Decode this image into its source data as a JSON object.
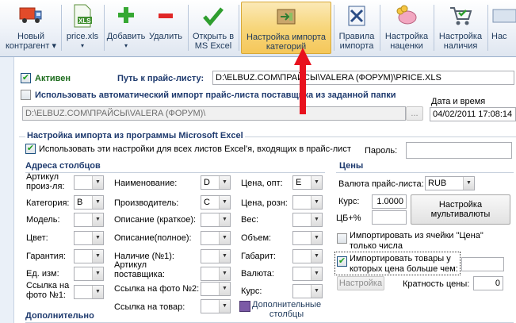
{
  "toolbar": {
    "buttons": [
      {
        "label1": "Новый",
        "label2": "контрагент ▾",
        "icon": "truck-icon"
      },
      {
        "label1": "price.xls",
        "label2": "▾",
        "icon": "xls-file-icon",
        "badge": "XLS"
      },
      {
        "label1": "Добавить",
        "label2": "▾",
        "icon": "plus-icon"
      },
      {
        "label1": "Удалить",
        "label2": "",
        "icon": "minus-icon"
      },
      {
        "label1": "Открыть в",
        "label2": "MS Excel",
        "icon": "checkmark-icon"
      },
      {
        "label1": "Настройка импорта",
        "label2": "категорий",
        "icon": "import-box-icon"
      },
      {
        "label1": "Правила",
        "label2": "импорта",
        "icon": "xls-rules-icon"
      },
      {
        "label1": "Настройка",
        "label2": "наценки",
        "icon": "piggy-bank-icon"
      },
      {
        "label1": "Настройка",
        "label2": "наличия",
        "icon": "cart-icon"
      },
      {
        "label1": "Нас",
        "label2": "",
        "icon": "settings-icon"
      }
    ]
  },
  "top": {
    "active_label": "Активен",
    "path_label": "Путь к прайс-листу:",
    "path_value": "D:\\ELBUZ.COM\\ПРАЙСЫ\\VALERA (ФОРУМ)\\PRICE.XLS",
    "auto_import_label": "Использовать автоматический импорт прайс-листа поставщика из заданной папки",
    "auto_folder_value": "D:\\ELBUZ.COM\\ПРАЙСЫ\\VALERA (ФОРУМ)\\",
    "browse_label": "...",
    "date_label": "Дата и время импорт",
    "date_value": "04/02/2011 17:08:14"
  },
  "excel": {
    "group_title": "Настройка импорта из программы Microsoft Excel",
    "all_sheets_label": "Использовать эти настройки для всех листов Excel'я, входящих в прайс-лист",
    "password_label": "Пароль:",
    "password_value": ""
  },
  "columns": {
    "title": "Адреса столбцов",
    "col1": [
      {
        "label": "Артикул произ-ля:",
        "value": ""
      },
      {
        "label": "Категория:",
        "value": "B"
      },
      {
        "label": "Модель:",
        "value": ""
      },
      {
        "label": "Цвет:",
        "value": ""
      },
      {
        "label": "Гарантия:",
        "value": ""
      },
      {
        "label": "Ед. изм:",
        "value": ""
      },
      {
        "label": "Ссылка на фото №1:",
        "value": ""
      }
    ],
    "col2": [
      {
        "label": "Наименование:",
        "value": "D"
      },
      {
        "label": "Производитель:",
        "value": "C"
      },
      {
        "label": "Описание (краткое):",
        "value": ""
      },
      {
        "label": "Описание(полное):",
        "value": ""
      },
      {
        "label": "Наличие (№1):",
        "value": ""
      },
      {
        "label": "Артикул поставщика:",
        "value": ""
      },
      {
        "label": "Ссылка на фото №2:",
        "value": ""
      },
      {
        "label": "Ссылка на товар:",
        "value": ""
      }
    ],
    "col3": [
      {
        "label": "Цена, опт:",
        "value": "E"
      },
      {
        "label": "Цена, розн:",
        "value": ""
      },
      {
        "label": "Вес:",
        "value": ""
      },
      {
        "label": "Объем:",
        "value": ""
      },
      {
        "label": "Габарит:",
        "value": ""
      },
      {
        "label": "Валюта:",
        "value": ""
      },
      {
        "label": "Курс:",
        "value": ""
      }
    ],
    "extra_columns_label1": "Дополнительные",
    "extra_columns_label2": "столбцы"
  },
  "prices": {
    "title": "Цены",
    "currency_label": "Валюта прайс-листа:",
    "currency_value": "RUB",
    "rate_label": "Курс:",
    "rate_value": "1.0000",
    "markup_label": "ЦБ+%",
    "markup_value": "",
    "multicurrency_label1": "Настройка",
    "multicurrency_label2": "мультивалюты",
    "import_from_cell_label1": "Импортировать из ячейки \"Цена\"",
    "import_from_cell_label2": "только числа",
    "import_goods_label1": "Импортировать товары у",
    "import_goods_label2": "которых цена больше чем:",
    "import_goods_value": "",
    "settings_button": "Настройка",
    "multiplicity_label": "Кратность цены:",
    "multiplicity_value": "0"
  },
  "more": {
    "title": "Дополнительно"
  }
}
